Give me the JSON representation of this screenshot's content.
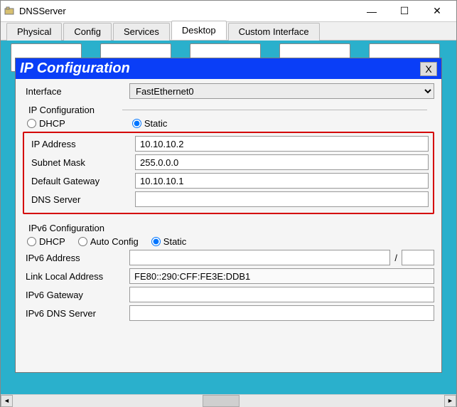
{
  "window": {
    "title": "DNSServer"
  },
  "tabs": [
    {
      "label": "Physical"
    },
    {
      "label": "Config"
    },
    {
      "label": "Services"
    },
    {
      "label": "Desktop",
      "active": true
    },
    {
      "label": "Custom Interface"
    }
  ],
  "subwindow": {
    "title": "IP Configuration",
    "close_label": "X",
    "interface_label": "Interface",
    "interface_value": "FastEthernet0",
    "ipv4": {
      "group_label": "IP Configuration",
      "dhcp_label": "DHCP",
      "static_label": "Static",
      "mode": "static",
      "ip_label": "IP Address",
      "ip_value": "10.10.10.2",
      "mask_label": "Subnet Mask",
      "mask_value": "255.0.0.0",
      "gw_label": "Default Gateway",
      "gw_value": "10.10.10.1",
      "dns_label": "DNS Server",
      "dns_value": ""
    },
    "ipv6": {
      "group_label": "IPv6 Configuration",
      "dhcp_label": "DHCP",
      "auto_label": "Auto Config",
      "static_label": "Static",
      "mode": "static",
      "addr_label": "IPv6 Address",
      "addr_value": "",
      "prefix_separator": "/",
      "prefix_value": "",
      "ll_label": "Link Local Address",
      "ll_value": "FE80::290:CFF:FE3E:DDB1",
      "gw_label": "IPv6 Gateway",
      "gw_value": "",
      "dns_label": "IPv6 DNS Server",
      "dns_value": ""
    }
  }
}
